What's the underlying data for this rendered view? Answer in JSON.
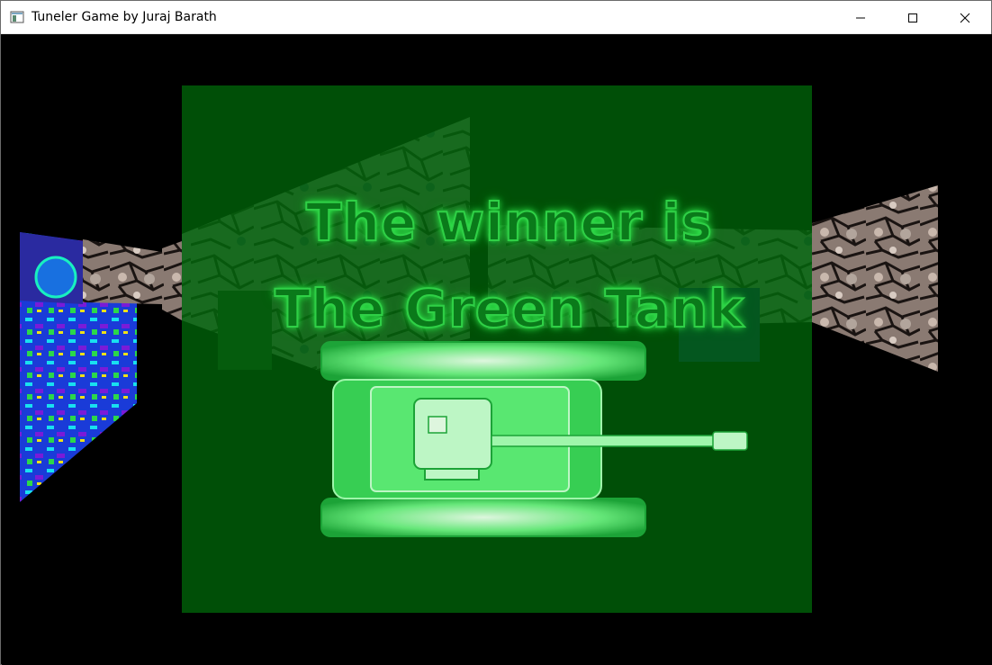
{
  "window": {
    "title": "Tuneler Game by Juraj Barath",
    "icons": {
      "app": "app-window-icon",
      "minimize": "minimize-icon",
      "maximize": "maximize-icon",
      "close": "close-icon"
    }
  },
  "game": {
    "winner_line_1": "The winner is",
    "winner_line_2": "The Green Tank",
    "overlay_color": "#005a08",
    "winner_color": "#2fd046",
    "tank_color": "#3ee85a"
  }
}
